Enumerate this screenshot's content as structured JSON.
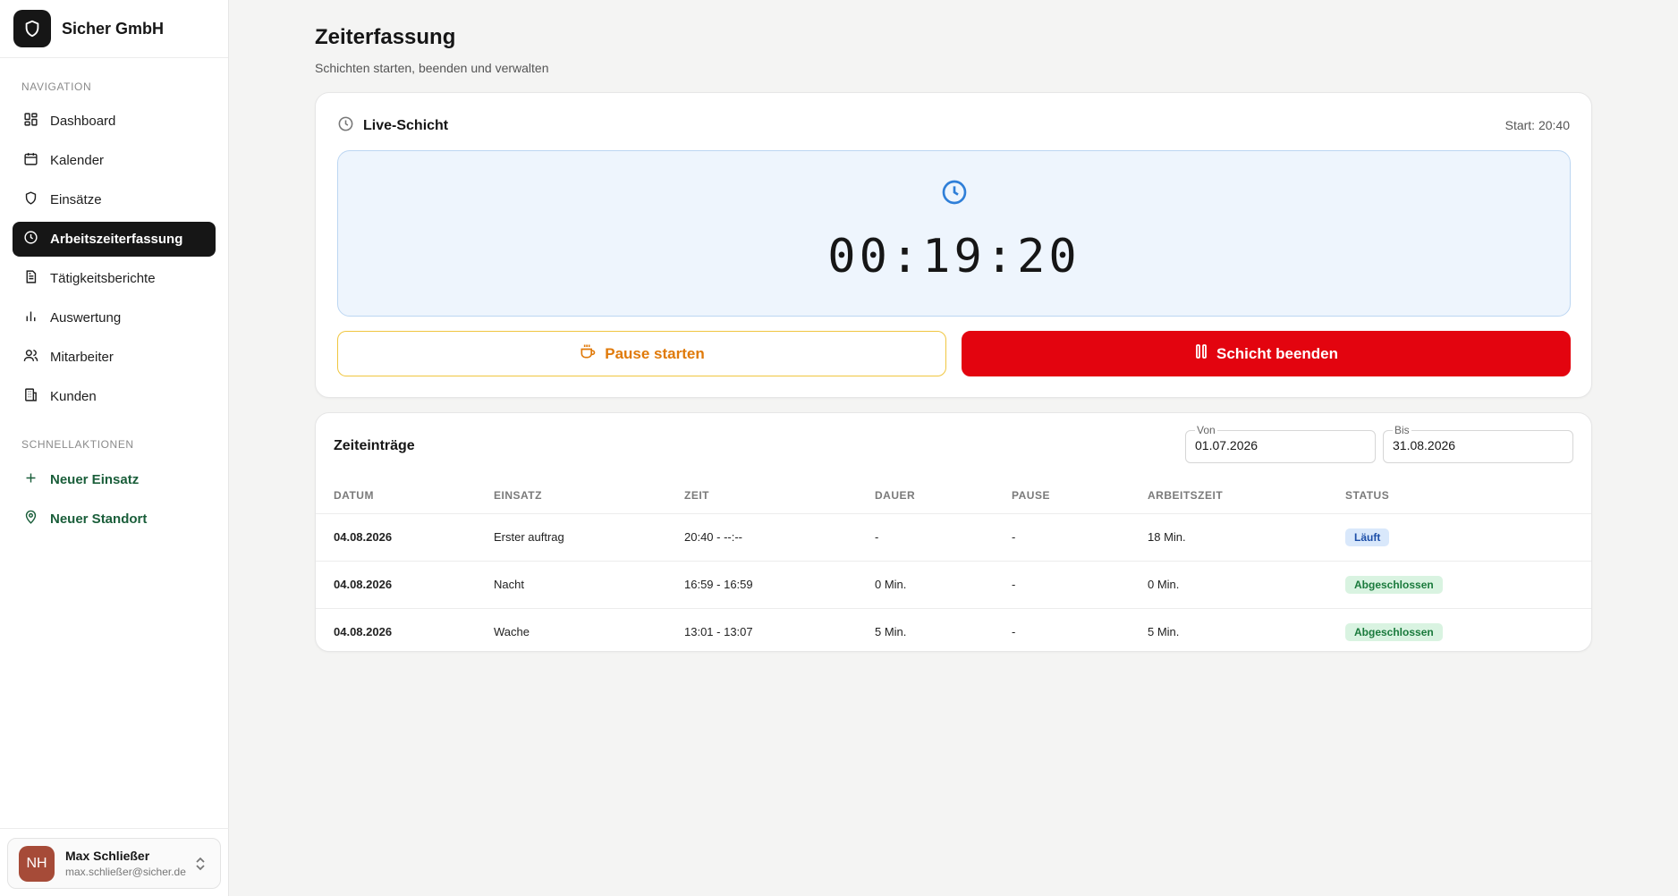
{
  "brand": {
    "name": "Sicher GmbH",
    "logo_icon": "shield-icon"
  },
  "sidebar": {
    "nav_heading": "NAVIGATION",
    "items": [
      {
        "label": "Dashboard",
        "icon": "dashboard-icon",
        "active": false
      },
      {
        "label": "Kalender",
        "icon": "calendar-icon",
        "active": false
      },
      {
        "label": "Einsätze",
        "icon": "shield-icon",
        "active": false
      },
      {
        "label": "Arbeitszeiterfassung",
        "icon": "clock-icon",
        "active": true
      },
      {
        "label": "Tätigkeitsberichte",
        "icon": "document-icon",
        "active": false
      },
      {
        "label": "Auswertung",
        "icon": "bar-chart-icon",
        "active": false
      },
      {
        "label": "Mitarbeiter",
        "icon": "users-icon",
        "active": false
      },
      {
        "label": "Kunden",
        "icon": "building-icon",
        "active": false
      }
    ],
    "quick_heading": "SCHNELLAKTIONEN",
    "quick_actions": [
      {
        "label": "Neuer Einsatz",
        "icon": "plus-icon"
      },
      {
        "label": "Neuer Standort",
        "icon": "map-pin-icon"
      }
    ],
    "user": {
      "initials": "NH",
      "name": "Max Schließer",
      "email": "max.schließer@sicher.de",
      "avatar_color": "#a64b38"
    }
  },
  "page": {
    "title": "Zeiterfassung",
    "subtitle": "Schichten starten, beenden und verwalten"
  },
  "live": {
    "title": "Live-Schicht",
    "start": "Start: 20:40",
    "timer": "00:19:20",
    "pause_button": "Pause starten",
    "end_button": "Schicht beenden"
  },
  "entries": {
    "title": "Zeiteinträge",
    "from_label": "Von",
    "from_value": "01.07.2026",
    "to_label": "Bis",
    "to_value": "31.08.2026",
    "columns": [
      "DATUM",
      "EINSATZ",
      "ZEIT",
      "DAUER",
      "PAUSE",
      "ARBEITSZEIT",
      "STATUS"
    ],
    "rows": [
      {
        "datum": "04.08.2026",
        "einsatz": "Erster auftrag",
        "zeit": "20:40 - --:--",
        "dauer": "-",
        "pause": "-",
        "arbeitszeit": "18 Min.",
        "status": "Läuft",
        "status_type": "running"
      },
      {
        "datum": "04.08.2026",
        "einsatz": "Nacht",
        "zeit": "16:59 - 16:59",
        "dauer": "0 Min.",
        "pause": "-",
        "arbeitszeit": "0 Min.",
        "status": "Abgeschlossen",
        "status_type": "done"
      },
      {
        "datum": "04.08.2026",
        "einsatz": "Wache",
        "zeit": "13:01 - 13:07",
        "dauer": "5 Min.",
        "pause": "-",
        "arbeitszeit": "5 Min.",
        "status": "Abgeschlossen",
        "status_type": "done"
      }
    ]
  },
  "colors": {
    "active_nav": "#161616",
    "quick_action": "#1a5e3a",
    "end_button": "#e3040f",
    "pause_button_text": "#e07a0a",
    "link": "#2563c9",
    "timer_box": "#eef5fd"
  }
}
